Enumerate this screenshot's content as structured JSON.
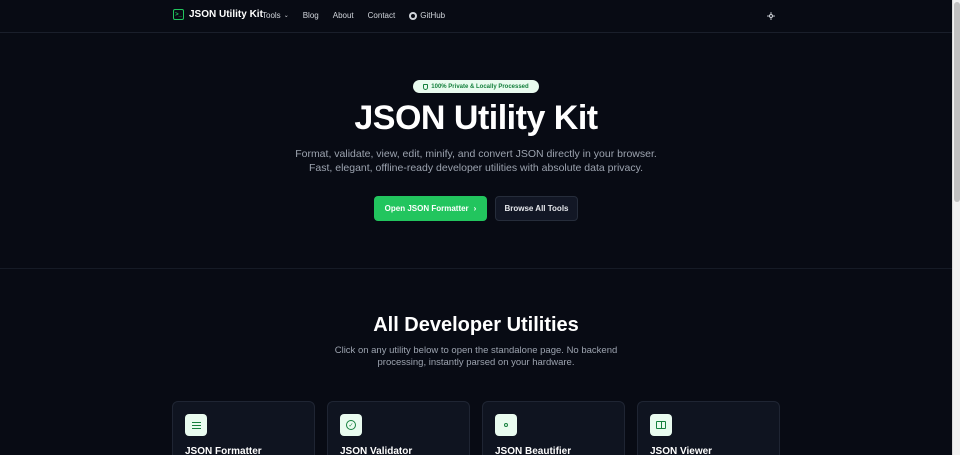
{
  "brand": {
    "name": "JSON Utility Kit",
    "icon": "terminal-icon"
  },
  "nav": {
    "links": [
      "Tools",
      "Blog",
      "About",
      "Contact",
      "GitHub"
    ],
    "theme_icon": "sun-icon"
  },
  "hero": {
    "badge": "100% Private & Locally Processed",
    "title": "JSON Utility Kit",
    "subtitle": "Format, validate, view, edit, minify, and convert JSON directly in your browser. Fast, elegant, offline-ready developer utilities with absolute data privacy.",
    "primary_button": "Open JSON Formatter",
    "secondary_button": "Browse All Tools"
  },
  "utilities": {
    "title": "All Developer Utilities",
    "subtitle": "Click on any utility below to open the standalone page. No backend processing, instantly parsed on your hardware.",
    "cards": [
      {
        "name": "JSON Formatter",
        "icon": "align-lines-icon"
      },
      {
        "name": "JSON Validator",
        "icon": "check-circle-icon"
      },
      {
        "name": "JSON Beautifier",
        "icon": "sparkle-icon"
      },
      {
        "name": "JSON Viewer",
        "icon": "book-open-icon"
      }
    ]
  },
  "colors": {
    "background": "#080b14",
    "accent": "#22c55e",
    "badge_bg": "#e9fbef"
  }
}
